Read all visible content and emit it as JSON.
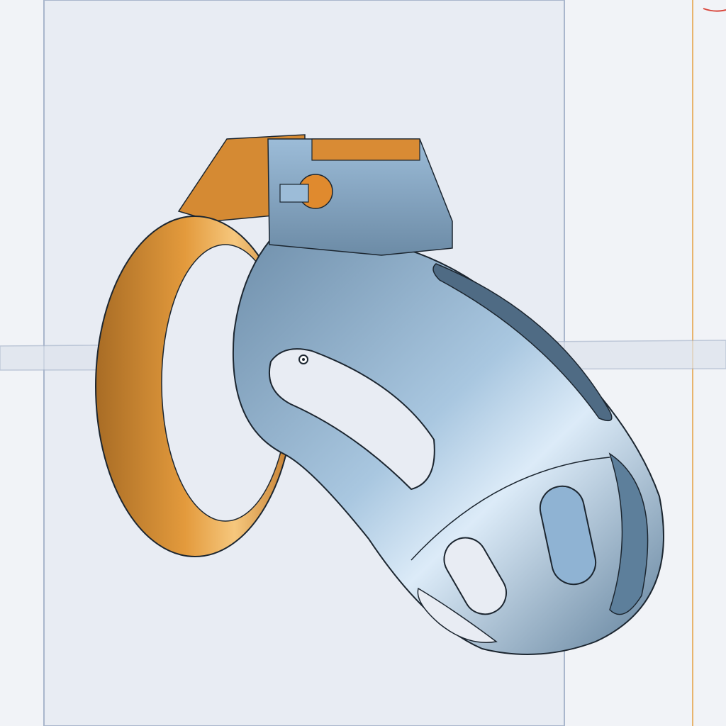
{
  "viewport": {
    "background": "#f1f3f7",
    "plane_fill": "#e6eaf1",
    "plane_edge": "#a9b6cc",
    "right_plane_edge": "#e8b46e",
    "corner_mark_color": "#d9453a"
  },
  "model": {
    "ring": {
      "color": "#e39a3c",
      "shadow": "#a86c25",
      "highlight": "#f6c77d"
    },
    "cage": {
      "color": "#8fb3d3",
      "shadow": "#5d7f9b",
      "highlight": "#dcebf8",
      "edge": "#1c2630"
    },
    "lock_insert_color": "#e08a2e"
  },
  "icons": {
    "origin": "origin-point-icon"
  }
}
